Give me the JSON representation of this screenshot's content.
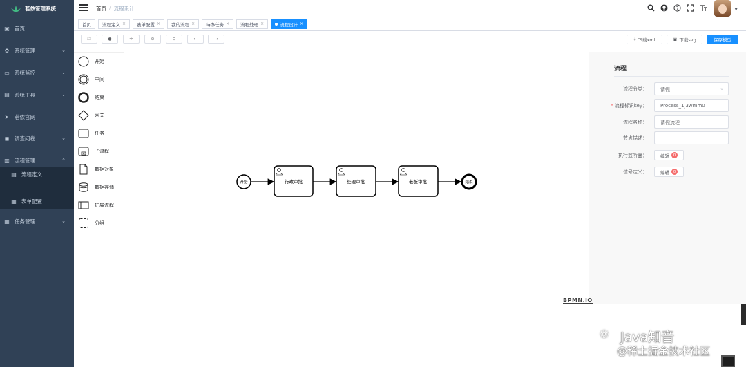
{
  "app": {
    "title": "若依管理系统"
  },
  "sidebar": {
    "items": [
      {
        "label": "首页",
        "icon": "dashboard-icon"
      },
      {
        "label": "系统管理",
        "icon": "gear-icon",
        "arrow": "⌄"
      },
      {
        "label": "系统监控",
        "icon": "monitor-icon",
        "arrow": "⌄"
      },
      {
        "label": "系统工具",
        "icon": "tool-icon",
        "arrow": "⌄"
      },
      {
        "label": "若依官网",
        "icon": "send-icon"
      },
      {
        "label": "调查问卷",
        "icon": "chat-icon",
        "arrow": "⌄"
      },
      {
        "label": "流程管理",
        "icon": "workflow-icon",
        "arrow": "⌃"
      },
      {
        "label": "流程定义",
        "icon": "doc-icon"
      },
      {
        "label": "表单配置",
        "icon": "form-icon"
      },
      {
        "label": "任务管理",
        "icon": "task-icon",
        "arrow": "⌄"
      }
    ]
  },
  "header": {
    "breadcrumb": [
      "首页",
      "流程设计"
    ],
    "breadcrumb_sep": "/"
  },
  "tags": [
    {
      "label": "首页"
    },
    {
      "label": "流程定义",
      "close": "×"
    },
    {
      "label": "表单配置",
      "close": "×"
    },
    {
      "label": "我的流程",
      "close": "×"
    },
    {
      "label": "待办任务",
      "close": "×"
    },
    {
      "label": "流程处理",
      "close": "×"
    },
    {
      "label": "流程设计",
      "close": "×",
      "active": true
    }
  ],
  "toolbar": {
    "download_xml": "下载xml",
    "download_svg": "下载svg",
    "save": "保存模型"
  },
  "palette": [
    {
      "label": "开始",
      "shape": "start-event"
    },
    {
      "label": "中间",
      "shape": "intermediate-event"
    },
    {
      "label": "结束",
      "shape": "end-event"
    },
    {
      "label": "网关",
      "shape": "gateway"
    },
    {
      "label": "任务",
      "shape": "task"
    },
    {
      "label": "子流程",
      "shape": "subprocess"
    },
    {
      "label": "数据对象",
      "shape": "data-object"
    },
    {
      "label": "数据存储",
      "shape": "data-store"
    },
    {
      "label": "扩展流程",
      "shape": "pool"
    },
    {
      "label": "分组",
      "shape": "group"
    }
  ],
  "diagram": {
    "start_label": "开始",
    "end_label": "结束",
    "tasks": [
      "行政审批",
      "经理审批",
      "老板审批"
    ]
  },
  "props": {
    "title": "流程",
    "rows": [
      {
        "label": "流程分类：",
        "value": "请假",
        "type": "select"
      },
      {
        "label": "流程标识key：",
        "value": "Process_1j3wmm0",
        "type": "input",
        "required": true
      },
      {
        "label": "流程名称：",
        "value": "请假流程",
        "type": "input"
      },
      {
        "label": "节点描述：",
        "value": "",
        "type": "input"
      },
      {
        "label": "执行监听器：",
        "value": "编辑",
        "type": "button",
        "badge": "0"
      },
      {
        "label": "信号定义：",
        "value": "编辑",
        "type": "button",
        "badge": "0"
      }
    ]
  },
  "watermark": {
    "brand": "BPMN.iO",
    "line1": "Java知音",
    "line2": "@稀土掘金技术社区"
  }
}
